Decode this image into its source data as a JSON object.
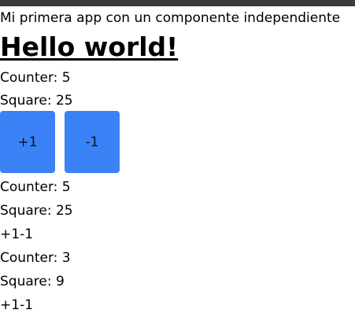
{
  "window": {
    "subtitle": "Mi primera app con un componente independiente"
  },
  "main": {
    "heading": "Hello world!",
    "top_block": {
      "counter_label": "Counter: 5",
      "square_label": "Square: 25"
    },
    "buttons": {
      "plus_label": "+1",
      "minus_label": "-1"
    },
    "component_1": {
      "counter_label": "Counter: 5",
      "square_label": "Square: 25",
      "plus_text": "+1",
      "minus_text": "-1"
    },
    "component_2": {
      "counter_label": "Counter: 3",
      "square_label": "Square: 9",
      "plus_text": "+1",
      "minus_text": "-1"
    }
  },
  "colors": {
    "button_bg": "#3b82f6",
    "topbar": "#3a3a3a"
  }
}
